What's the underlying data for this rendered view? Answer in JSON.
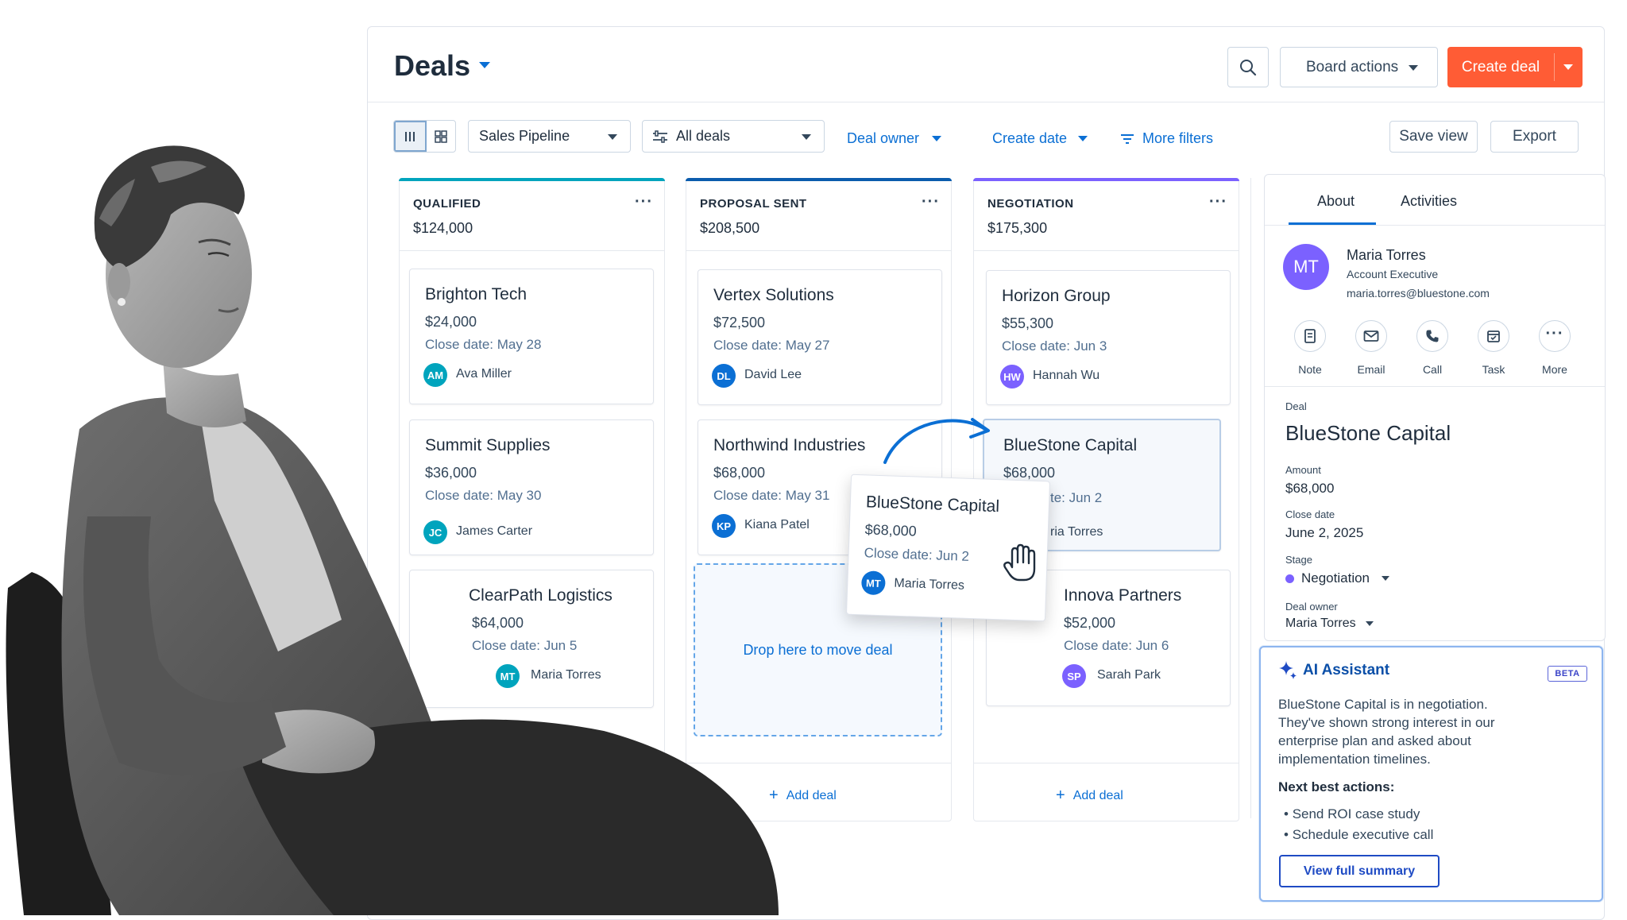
{
  "header": {
    "title": "Deals",
    "board_actions": "Board actions",
    "create_deal": "Create deal"
  },
  "filters": {
    "pipeline": "Sales Pipeline",
    "deals_view": "All deals",
    "deal_owner": "Deal owner",
    "create_date": "Create date",
    "more_filters": "More filters",
    "save_view": "Save view",
    "export": "Export"
  },
  "columns": [
    {
      "title": "QUALIFIED",
      "amount": "$124,000",
      "color": "#00a4bd",
      "cards": [
        {
          "name": "Brighton Tech",
          "amount": "$24,000",
          "close": "Close date: May 28",
          "initials": "AM",
          "owner": "Ava Miller",
          "color": "#00a4bd"
        },
        {
          "name": "Summit Supplies",
          "amount": "$36,000",
          "close": "Close date: May 30",
          "initials": "JC",
          "owner": "James Carter",
          "color": "#00a4bd"
        },
        {
          "name": "ClearPath Logistics",
          "amount": "$64,000",
          "close": "Close date: Jun 5",
          "initials": "MT",
          "owner": "Maria Torres",
          "color": "#00a4bd"
        }
      ]
    },
    {
      "title": "PROPOSAL SENT",
      "amount": "$208,500",
      "color": "#0b5cad",
      "cards": [
        {
          "name": "Vertex Solutions",
          "amount": "$72,500",
          "close": "Close date: May 27",
          "initials": "DL",
          "owner": "David Lee",
          "color": "#0b6fd4"
        },
        {
          "name": "Northwind Industries",
          "amount": "$68,000",
          "close": "Close date: May 31",
          "initials": "KP",
          "owner": "Kiana Patel",
          "color": "#0b6fd4"
        }
      ],
      "drop_zone": "Drop here to move deal",
      "add_deal": "Add deal"
    },
    {
      "title": "NEGOTIATION",
      "amount": "$175,300",
      "color": "#7b61ff",
      "cards": [
        {
          "name": "Horizon Group",
          "amount": "$55,300",
          "close": "Close date: Jun 3",
          "initials": "HW",
          "owner": "Hannah Wu",
          "color": "#7b61ff"
        },
        {
          "name": "BlueStone Capital",
          "amount": "$68,000",
          "close_partial": "te: Jun 2",
          "owner_partial": "ria Torres"
        },
        {
          "name": "Innova Partners",
          "amount": "$52,000",
          "close": "Close date: Jun 6",
          "initials": "SP",
          "owner": "Sarah Park",
          "color": "#7b61ff"
        }
      ],
      "add_deal": "Add deal"
    }
  ],
  "dragging": {
    "name": "BlueStone Capital",
    "amount": "$68,000",
    "close": "Close date: Jun 2",
    "initials": "MT",
    "owner": "Maria Torres"
  },
  "panel": {
    "tabs": [
      "About",
      "Activities"
    ],
    "contact": {
      "initials": "MT",
      "name": "Maria Torres",
      "role": "Account Executive",
      "email": "maria.torres@bluestone.com"
    },
    "actions": [
      "Note",
      "Email",
      "Call",
      "Task",
      "More"
    ],
    "deal_label": "Deal",
    "deal_name": "BlueStone Capital",
    "amount_label": "Amount",
    "amount": "$68,000",
    "close_label": "Close date",
    "close": "June 2, 2025",
    "stage_label": "Stage",
    "stage": "Negotiation",
    "owner_label": "Deal owner",
    "owner": "Maria Torres"
  },
  "ai": {
    "title": "AI Assistant",
    "badge": "BETA",
    "desc": "BlueStone Capital is in negotiation. They've shown strong interest in our enterprise plan and asked about implementation timelines.",
    "next_title": "Next best actions:",
    "bullets": [
      "Send ROI case study",
      "Schedule executive call"
    ],
    "button": "View full summary"
  },
  "colors": {
    "accent": "#0b6fd4",
    "create": "#ff5c35",
    "qualified": "#00a4bd",
    "proposal": "#0b5cad",
    "negotiation": "#7b61ff"
  }
}
